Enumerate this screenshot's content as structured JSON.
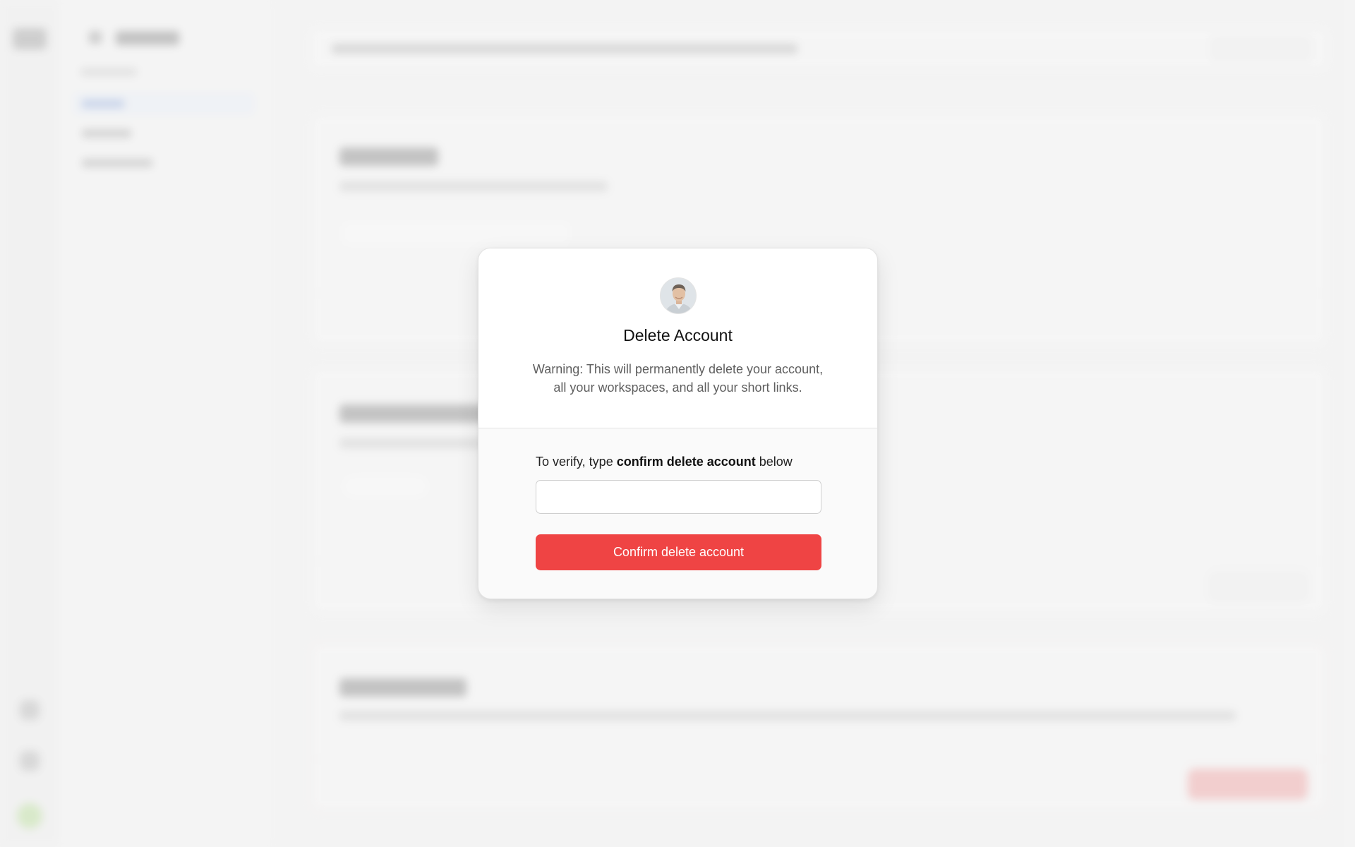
{
  "modal": {
    "title": "Delete Account",
    "warning": "Warning: This will permanently delete your account, all your workspaces, and all your short links.",
    "verify_prefix": "To verify, type ",
    "verify_phrase": "confirm delete account",
    "verify_suffix": " below",
    "input_value": "",
    "confirm_button": "Confirm delete account"
  },
  "colors": {
    "danger": "#ef4444",
    "backdrop": "#f3f3f3"
  },
  "icons": {
    "avatar": "user-avatar-photo"
  }
}
